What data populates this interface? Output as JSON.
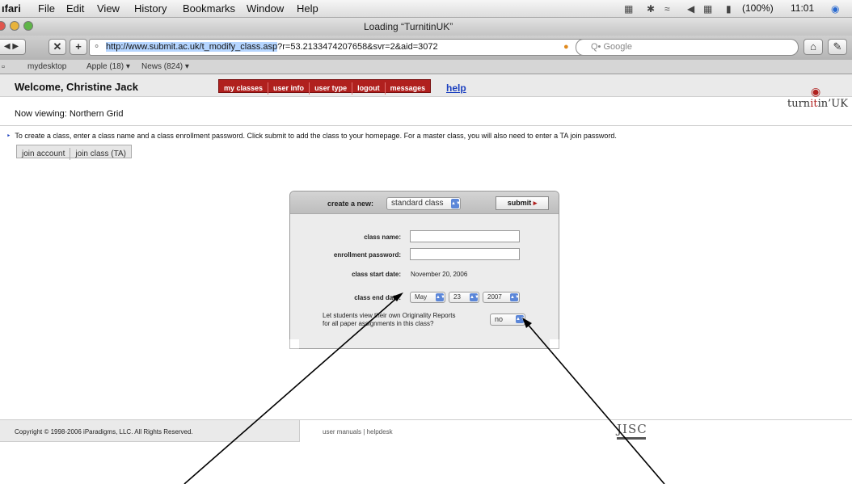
{
  "menubar": {
    "app": "ıfari",
    "items": [
      "File",
      "Edit",
      "View",
      "History",
      "Bookmarks",
      "Window",
      "Help"
    ],
    "battery": "(100%)",
    "clock": "11:01"
  },
  "window": {
    "title": "Loading “TurnitinUK”"
  },
  "toolbar": {
    "url_selected": "http://www.submit.ac.uk/t_modify_class.asp",
    "url_rest": "?r=53.2133474207658&svr=2&aid=3072",
    "search_placeholder": "Q• Google"
  },
  "bookmarks": [
    "mydesktop",
    "Apple (18) ▾",
    "News (824) ▾"
  ],
  "header": {
    "welcome": "Welcome, Christine Jack",
    "nav": [
      "my classes",
      "user info",
      "user type",
      "logout",
      "messages"
    ],
    "help": "help",
    "logo_text_a": "turn",
    "logo_text_b": "it",
    "logo_text_c": "in",
    "logo_text_d": "UK",
    "viewing": "Now viewing: Northern Grid",
    "instructions": "To create a class, enter a class name and a class enrollment password. Click submit to add the class to your homepage. For a master class, you will also need to enter a TA join password.",
    "subtabs": [
      "join account",
      "join class (TA)"
    ]
  },
  "form": {
    "create_label": "create a new:",
    "create_value": "standard class",
    "submit": "submit",
    "class_name_label": "class name:",
    "class_name_value": "",
    "enroll_label": "enrollment password:",
    "enroll_value": "",
    "start_label": "class start date:",
    "start_value": "November 20, 2006",
    "end_label": "class end date:",
    "end_month": "May",
    "end_day": "23",
    "end_year": "2007",
    "originality_line1": "Let students view their own Originality Reports",
    "originality_line2": "for all paper assignments in this class?",
    "originality_value": "no"
  },
  "footer": {
    "copyright": "Copyright © 1998-2006 iParadigms, LLC. All Rights Reserved.",
    "links": "user manuals | helpdesk",
    "jisc": "JISC"
  }
}
